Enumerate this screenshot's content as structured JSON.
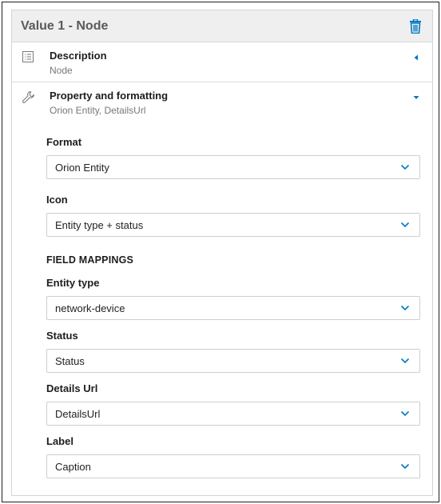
{
  "panel": {
    "title": "Value 1 - Node",
    "delete_icon": "trash-icon"
  },
  "description": {
    "icon": "list-icon",
    "title": "Description",
    "subtitle": "Node",
    "toggle_icon": "caret-left-icon"
  },
  "property": {
    "icon": "wrench-icon",
    "title": "Property and formatting",
    "subtitle": "Orion Entity, DetailsUrl",
    "toggle_icon": "caret-down-icon"
  },
  "format": {
    "label": "Format",
    "value": "Orion Entity"
  },
  "icon_field": {
    "label": "Icon",
    "value": "Entity type + status"
  },
  "field_mappings": {
    "heading": "FIELD MAPPINGS"
  },
  "entity_type": {
    "label": "Entity type",
    "value": "network-device"
  },
  "status": {
    "label": "Status",
    "value": "Status"
  },
  "details_url": {
    "label": "Details Url",
    "value": "DetailsUrl"
  },
  "label_field": {
    "label": "Label",
    "value": "Caption"
  },
  "colors": {
    "accent": "#0079c2",
    "header_bg": "#efefef",
    "title_gray": "#5a5a5a"
  }
}
